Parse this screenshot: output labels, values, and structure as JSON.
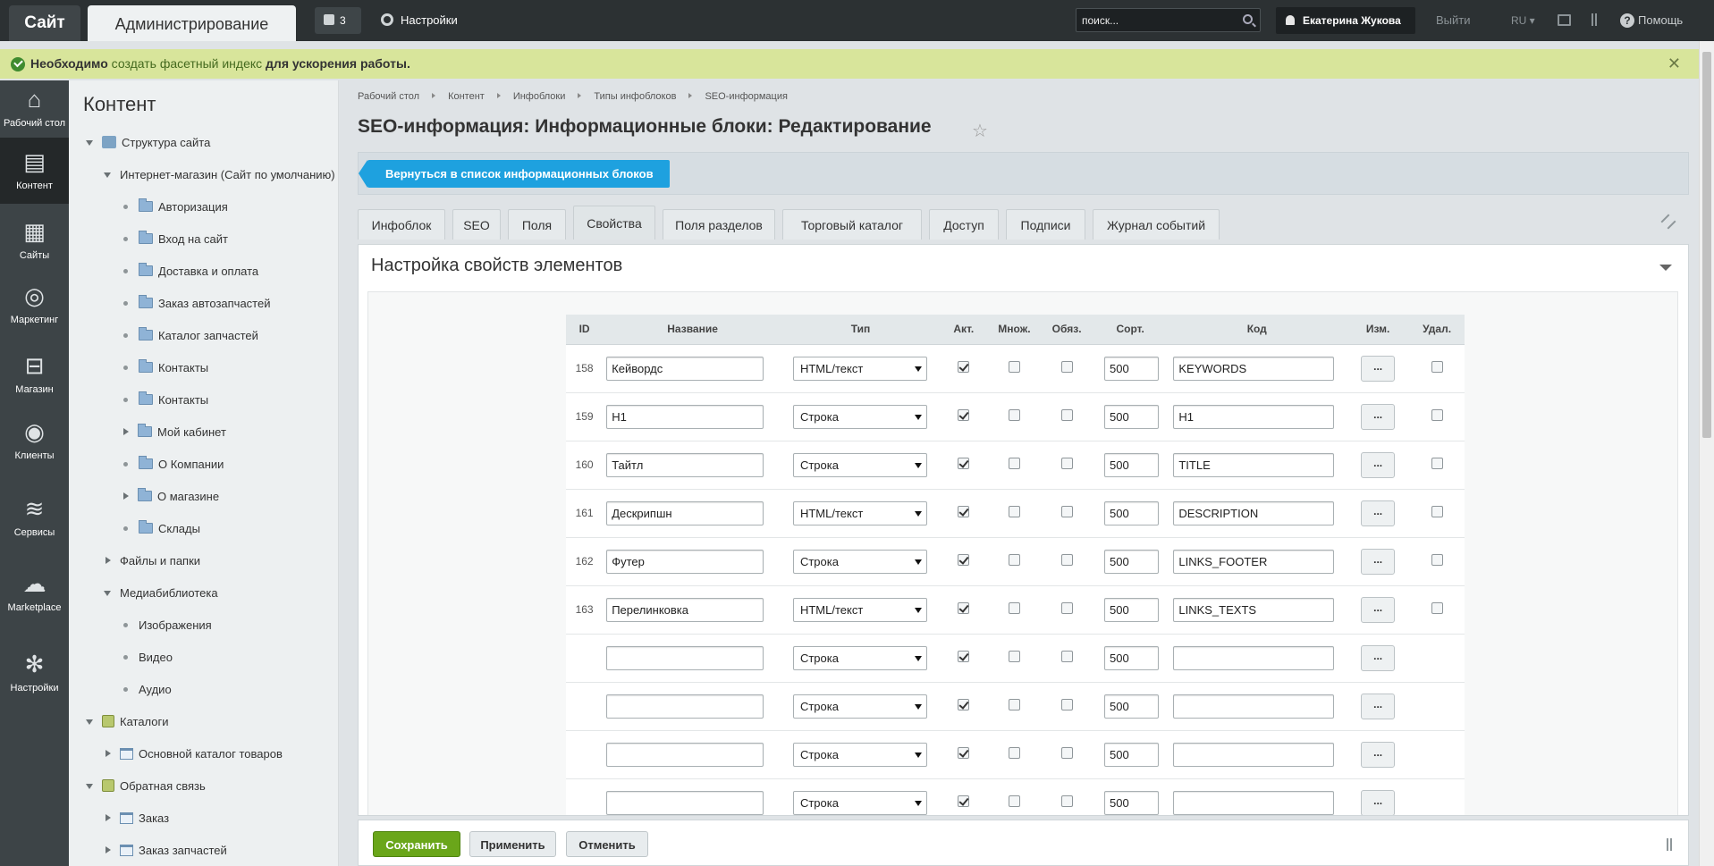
{
  "topbar": {
    "site_label": "Сайт",
    "admin_label": "Администрирование",
    "notify_count": "3",
    "settings_label": "Настройки",
    "search_placeholder": "поиск...",
    "user_name": "Екатерина Жукова",
    "logout_label": "Выйти",
    "lang": "RU",
    "help_label": "Помощь"
  },
  "notice": {
    "prefix": "Необходимо",
    "link": "создать фасетный индекс",
    "suffix": "для ускорения работы."
  },
  "rail": [
    {
      "label": "Рабочий стол",
      "icon": "home-icon"
    },
    {
      "label": "Контент",
      "icon": "document-icon"
    },
    {
      "label": "Сайты",
      "icon": "calendar-icon"
    },
    {
      "label": "Маркетинг",
      "icon": "target-icon"
    },
    {
      "label": "Магазин",
      "icon": "basket-icon"
    },
    {
      "label": "Клиенты",
      "icon": "clients-icon"
    },
    {
      "label": "Сервисы",
      "icon": "layers-icon"
    },
    {
      "label": "Marketplace",
      "icon": "cloud-icon"
    },
    {
      "label": "Настройки",
      "icon": "gear-icon"
    }
  ],
  "tree": {
    "title": "Контент",
    "items": [
      {
        "label": "Структура сайта"
      },
      {
        "label": "Интернет-магазин (Сайт по умолчанию)"
      },
      {
        "label": "Авторизация"
      },
      {
        "label": "Вход на сайт"
      },
      {
        "label": "Доставка и оплата"
      },
      {
        "label": "Заказ автозапчастей"
      },
      {
        "label": "Каталог запчастей"
      },
      {
        "label": "Контакты"
      },
      {
        "label": "Контакты"
      },
      {
        "label": "Мой кабинет"
      },
      {
        "label": "О Компании"
      },
      {
        "label": "О магазине"
      },
      {
        "label": "Склады"
      },
      {
        "label": "Файлы и папки"
      },
      {
        "label": "Медиабиблиотека"
      },
      {
        "label": "Изображения"
      },
      {
        "label": "Видео"
      },
      {
        "label": "Аудио"
      },
      {
        "label": "Каталоги"
      },
      {
        "label": "Основной каталог товаров"
      },
      {
        "label": "Обратная связь"
      },
      {
        "label": "Заказ"
      },
      {
        "label": "Заказ запчастей"
      }
    ]
  },
  "breadcrumbs": [
    "Рабочий стол",
    "Контент",
    "Инфоблоки",
    "Типы инфоблоков",
    "SEO-информация"
  ],
  "page_title": "SEO-информация: Информационные блоки: Редактирование",
  "back_button": "Вернуться в список информационных блоков",
  "tabs": [
    "Инфоблок",
    "SEO",
    "Поля",
    "Свойства",
    "Поля разделов",
    "Торговый каталог",
    "Доступ",
    "Подписи",
    "Журнал событий"
  ],
  "active_tab": "Свойства",
  "section_title": "Настройка свойств элементов",
  "table": {
    "headers": [
      "ID",
      "Название",
      "Тип",
      "Акт.",
      "Множ.",
      "Обяз.",
      "Сорт.",
      "Код",
      "Изм.",
      "Удал."
    ],
    "rows": [
      {
        "id": "158",
        "name": "Кейвордс",
        "type": "HTML/текст",
        "active": true,
        "multiple": false,
        "required": false,
        "sort": "500",
        "code": "KEYWORDS",
        "edit": "...",
        "delete": false
      },
      {
        "id": "159",
        "name": "H1",
        "type": "Строка",
        "active": true,
        "multiple": false,
        "required": false,
        "sort": "500",
        "code": "H1",
        "edit": "...",
        "delete": false
      },
      {
        "id": "160",
        "name": "Тайтл",
        "type": "Строка",
        "active": true,
        "multiple": false,
        "required": false,
        "sort": "500",
        "code": "TITLE",
        "edit": "...",
        "delete": false
      },
      {
        "id": "161",
        "name": "Дескрипшн",
        "type": "HTML/текст",
        "active": true,
        "multiple": false,
        "required": false,
        "sort": "500",
        "code": "DESCRIPTION",
        "edit": "...",
        "delete": false
      },
      {
        "id": "162",
        "name": "Футер",
        "type": "Строка",
        "active": true,
        "multiple": false,
        "required": false,
        "sort": "500",
        "code": "LINKS_FOOTER",
        "edit": "...",
        "delete": false
      },
      {
        "id": "163",
        "name": "Перелинковка",
        "type": "HTML/текст",
        "active": true,
        "multiple": false,
        "required": false,
        "sort": "500",
        "code": "LINKS_TEXTS",
        "edit": "...",
        "delete": false
      },
      {
        "id": "",
        "name": "",
        "type": "Строка",
        "active": true,
        "multiple": false,
        "required": false,
        "sort": "500",
        "code": "",
        "edit": "..."
      },
      {
        "id": "",
        "name": "",
        "type": "Строка",
        "active": true,
        "multiple": false,
        "required": false,
        "sort": "500",
        "code": "",
        "edit": "..."
      },
      {
        "id": "",
        "name": "",
        "type": "Строка",
        "active": true,
        "multiple": false,
        "required": false,
        "sort": "500",
        "code": "",
        "edit": "..."
      },
      {
        "id": "",
        "name": "",
        "type": "Строка",
        "active": true,
        "multiple": false,
        "required": false,
        "sort": "500",
        "code": "",
        "edit": "..."
      }
    ]
  },
  "footer": {
    "save": "Сохранить",
    "apply": "Применить",
    "cancel": "Отменить"
  }
}
